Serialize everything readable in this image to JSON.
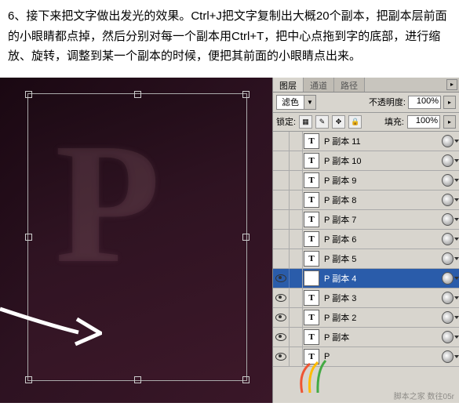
{
  "instructions": "6、接下来把文字做出发光的效果。Ctrl+J把文字复制出大概20个副本，把副本层前面的小眼睛都点掉，然后分别对每一个副本用Ctrl+T，把中心点拖到字的底部，进行缩放、旋转，调整到某一个副本的时候，便把其前面的小眼睛点出来。",
  "tabs": {
    "layers": "图层",
    "channels": "通道",
    "paths": "路径"
  },
  "blend_mode": "滤色",
  "opacity_label": "不透明度:",
  "opacity_value": "100%",
  "lock_label": "锁定:",
  "fill_label": "填充:",
  "fill_value": "100%",
  "layers": [
    {
      "name": "P 副本 11",
      "visible": false,
      "selected": false
    },
    {
      "name": "P 副本 10",
      "visible": false,
      "selected": false
    },
    {
      "name": "P 副本 9",
      "visible": false,
      "selected": false
    },
    {
      "name": "P 副本 8",
      "visible": false,
      "selected": false
    },
    {
      "name": "P 副本 7",
      "visible": false,
      "selected": false
    },
    {
      "name": "P 副本 6",
      "visible": false,
      "selected": false
    },
    {
      "name": "P 副本 5",
      "visible": false,
      "selected": false
    },
    {
      "name": "P 副本 4",
      "visible": true,
      "selected": true
    },
    {
      "name": "P 副本 3",
      "visible": true,
      "selected": false
    },
    {
      "name": "P 副本 2",
      "visible": true,
      "selected": false
    },
    {
      "name": "P 副本",
      "visible": true,
      "selected": false
    },
    {
      "name": "P",
      "visible": true,
      "selected": false
    }
  ],
  "letter": "P",
  "thumb_letter": "T",
  "watermark": "脚本之家 数往05r"
}
